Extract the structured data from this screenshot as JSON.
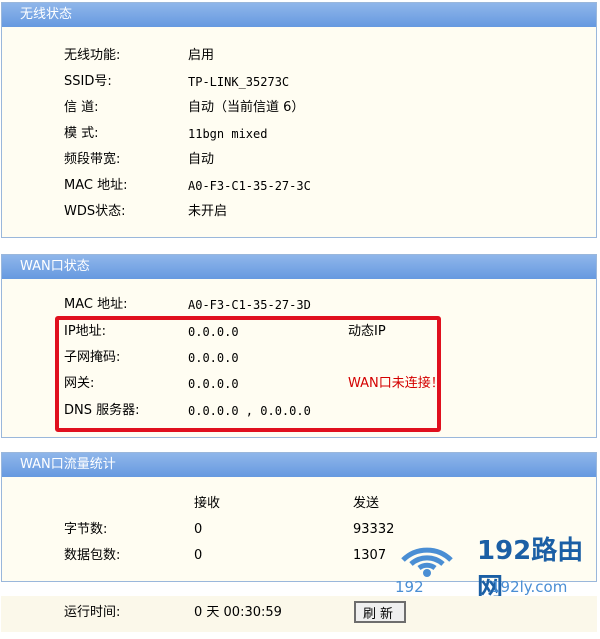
{
  "wireless": {
    "title": "无线状态",
    "rows": [
      {
        "label": "无线功能:",
        "value": "启用"
      },
      {
        "label": "SSID号:",
        "value": "TP-LINK_35273C"
      },
      {
        "label": "信 道:",
        "value": "自动（当前信道 6）"
      },
      {
        "label": "模 式:",
        "value": "11bgn mixed"
      },
      {
        "label": "频段带宽:",
        "value": "自动"
      },
      {
        "label": "MAC 地址:",
        "value": "A0-F3-C1-35-27-3C"
      },
      {
        "label": "WDS状态:",
        "value": "未开启"
      }
    ]
  },
  "wan": {
    "title": "WAN口状态",
    "rows": [
      {
        "label": "MAC 地址:",
        "value": "A0-F3-C1-35-27-3D",
        "extra": ""
      },
      {
        "label": "IP地址:",
        "value": "0.0.0.0",
        "extra": "动态IP"
      },
      {
        "label": "子网掩码:",
        "value": "0.0.0.0",
        "extra": ""
      },
      {
        "label": "网关:",
        "value": "0.0.0.0",
        "extra": "WAN口未连接！"
      },
      {
        "label": "DNS 服务器:",
        "value": "0.0.0.0 , 0.0.0.0",
        "extra": ""
      }
    ],
    "status_color": "#d40000",
    "highlight_color": "#e0101e"
  },
  "traffic": {
    "title": "WAN口流量统计",
    "headers": {
      "recv": "接收",
      "send": "发送"
    },
    "rows": [
      {
        "label": "字节数:",
        "recv": "0",
        "send": "93332"
      },
      {
        "label": "数据包数:",
        "recv": "0",
        "send": "1307"
      }
    ]
  },
  "runtime": {
    "label": "运行时间:",
    "value": "0 天 00:30:59",
    "refresh_label": "刷新"
  },
  "watermark": {
    "main": "192路由网",
    "sub": "192",
    "sub2": "192ly.com",
    "icon": "wifi-router-icon"
  },
  "colors": {
    "header_bg": "#6e9fe2",
    "panel_bg": "#fffdf2",
    "panel_border": "#9ab7db"
  }
}
